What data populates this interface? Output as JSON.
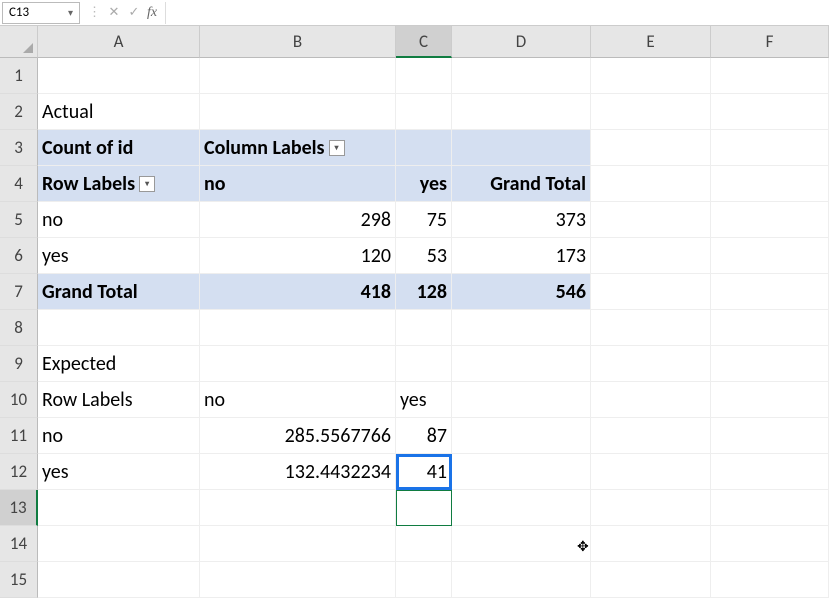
{
  "namebox": "C13",
  "formula": "",
  "columns": [
    "A",
    "B",
    "C",
    "D",
    "E",
    "F"
  ],
  "rows": [
    "1",
    "2",
    "3",
    "4",
    "5",
    "6",
    "7",
    "8",
    "9",
    "10",
    "11",
    "12",
    "13",
    "14",
    "15"
  ],
  "pivot1": {
    "title": "Actual",
    "count_of": "Count of id",
    "col_labels": "Column Labels",
    "row_labels": "Row Labels",
    "col_no": "no",
    "col_yes": "yes",
    "grand_total_col": "Grand Total",
    "row_no": "no",
    "row_yes": "yes",
    "grand_total_row": "Grand Total",
    "b5": "298",
    "c5": "75",
    "d5": "373",
    "b6": "120",
    "c6": "53",
    "d6": "173",
    "b7": "418",
    "c7": "128",
    "d7": "546"
  },
  "pivot2": {
    "title": "Expected",
    "row_labels": "Row Labels",
    "col_no": "no",
    "col_yes": "yes",
    "row_no": "no",
    "row_yes": "yes",
    "b11": "285.5567766",
    "c11": "87",
    "b12": "132.4432234",
    "c12": "41"
  },
  "cursor_glyph": "✥"
}
